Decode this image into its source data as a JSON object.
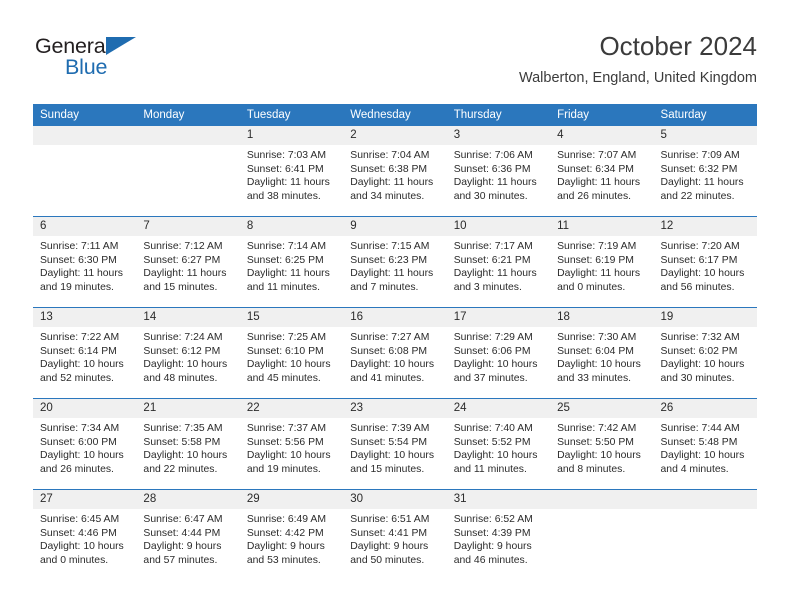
{
  "logo": {
    "word_top": "General",
    "word_bottom": "Blue",
    "accent_color": "#1f6cb0"
  },
  "header": {
    "title": "October 2024",
    "subtitle": "Walberton, England, United Kingdom"
  },
  "calendar": {
    "header_color": "#2b77bd",
    "daynum_band_color": "#f0f0f0",
    "weekday_headers": [
      "Sunday",
      "Monday",
      "Tuesday",
      "Wednesday",
      "Thursday",
      "Friday",
      "Saturday"
    ],
    "weeks": [
      [
        {
          "day": "",
          "sunrise": "",
          "sunset": "",
          "daylight": ""
        },
        {
          "day": "",
          "sunrise": "",
          "sunset": "",
          "daylight": ""
        },
        {
          "day": "1",
          "sunrise": "Sunrise: 7:03 AM",
          "sunset": "Sunset: 6:41 PM",
          "daylight": "Daylight: 11 hours and 38 minutes."
        },
        {
          "day": "2",
          "sunrise": "Sunrise: 7:04 AM",
          "sunset": "Sunset: 6:38 PM",
          "daylight": "Daylight: 11 hours and 34 minutes."
        },
        {
          "day": "3",
          "sunrise": "Sunrise: 7:06 AM",
          "sunset": "Sunset: 6:36 PM",
          "daylight": "Daylight: 11 hours and 30 minutes."
        },
        {
          "day": "4",
          "sunrise": "Sunrise: 7:07 AM",
          "sunset": "Sunset: 6:34 PM",
          "daylight": "Daylight: 11 hours and 26 minutes."
        },
        {
          "day": "5",
          "sunrise": "Sunrise: 7:09 AM",
          "sunset": "Sunset: 6:32 PM",
          "daylight": "Daylight: 11 hours and 22 minutes."
        }
      ],
      [
        {
          "day": "6",
          "sunrise": "Sunrise: 7:11 AM",
          "sunset": "Sunset: 6:30 PM",
          "daylight": "Daylight: 11 hours and 19 minutes."
        },
        {
          "day": "7",
          "sunrise": "Sunrise: 7:12 AM",
          "sunset": "Sunset: 6:27 PM",
          "daylight": "Daylight: 11 hours and 15 minutes."
        },
        {
          "day": "8",
          "sunrise": "Sunrise: 7:14 AM",
          "sunset": "Sunset: 6:25 PM",
          "daylight": "Daylight: 11 hours and 11 minutes."
        },
        {
          "day": "9",
          "sunrise": "Sunrise: 7:15 AM",
          "sunset": "Sunset: 6:23 PM",
          "daylight": "Daylight: 11 hours and 7 minutes."
        },
        {
          "day": "10",
          "sunrise": "Sunrise: 7:17 AM",
          "sunset": "Sunset: 6:21 PM",
          "daylight": "Daylight: 11 hours and 3 minutes."
        },
        {
          "day": "11",
          "sunrise": "Sunrise: 7:19 AM",
          "sunset": "Sunset: 6:19 PM",
          "daylight": "Daylight: 11 hours and 0 minutes."
        },
        {
          "day": "12",
          "sunrise": "Sunrise: 7:20 AM",
          "sunset": "Sunset: 6:17 PM",
          "daylight": "Daylight: 10 hours and 56 minutes."
        }
      ],
      [
        {
          "day": "13",
          "sunrise": "Sunrise: 7:22 AM",
          "sunset": "Sunset: 6:14 PM",
          "daylight": "Daylight: 10 hours and 52 minutes."
        },
        {
          "day": "14",
          "sunrise": "Sunrise: 7:24 AM",
          "sunset": "Sunset: 6:12 PM",
          "daylight": "Daylight: 10 hours and 48 minutes."
        },
        {
          "day": "15",
          "sunrise": "Sunrise: 7:25 AM",
          "sunset": "Sunset: 6:10 PM",
          "daylight": "Daylight: 10 hours and 45 minutes."
        },
        {
          "day": "16",
          "sunrise": "Sunrise: 7:27 AM",
          "sunset": "Sunset: 6:08 PM",
          "daylight": "Daylight: 10 hours and 41 minutes."
        },
        {
          "day": "17",
          "sunrise": "Sunrise: 7:29 AM",
          "sunset": "Sunset: 6:06 PM",
          "daylight": "Daylight: 10 hours and 37 minutes."
        },
        {
          "day": "18",
          "sunrise": "Sunrise: 7:30 AM",
          "sunset": "Sunset: 6:04 PM",
          "daylight": "Daylight: 10 hours and 33 minutes."
        },
        {
          "day": "19",
          "sunrise": "Sunrise: 7:32 AM",
          "sunset": "Sunset: 6:02 PM",
          "daylight": "Daylight: 10 hours and 30 minutes."
        }
      ],
      [
        {
          "day": "20",
          "sunrise": "Sunrise: 7:34 AM",
          "sunset": "Sunset: 6:00 PM",
          "daylight": "Daylight: 10 hours and 26 minutes."
        },
        {
          "day": "21",
          "sunrise": "Sunrise: 7:35 AM",
          "sunset": "Sunset: 5:58 PM",
          "daylight": "Daylight: 10 hours and 22 minutes."
        },
        {
          "day": "22",
          "sunrise": "Sunrise: 7:37 AM",
          "sunset": "Sunset: 5:56 PM",
          "daylight": "Daylight: 10 hours and 19 minutes."
        },
        {
          "day": "23",
          "sunrise": "Sunrise: 7:39 AM",
          "sunset": "Sunset: 5:54 PM",
          "daylight": "Daylight: 10 hours and 15 minutes."
        },
        {
          "day": "24",
          "sunrise": "Sunrise: 7:40 AM",
          "sunset": "Sunset: 5:52 PM",
          "daylight": "Daylight: 10 hours and 11 minutes."
        },
        {
          "day": "25",
          "sunrise": "Sunrise: 7:42 AM",
          "sunset": "Sunset: 5:50 PM",
          "daylight": "Daylight: 10 hours and 8 minutes."
        },
        {
          "day": "26",
          "sunrise": "Sunrise: 7:44 AM",
          "sunset": "Sunset: 5:48 PM",
          "daylight": "Daylight: 10 hours and 4 minutes."
        }
      ],
      [
        {
          "day": "27",
          "sunrise": "Sunrise: 6:45 AM",
          "sunset": "Sunset: 4:46 PM",
          "daylight": "Daylight: 10 hours and 0 minutes."
        },
        {
          "day": "28",
          "sunrise": "Sunrise: 6:47 AM",
          "sunset": "Sunset: 4:44 PM",
          "daylight": "Daylight: 9 hours and 57 minutes."
        },
        {
          "day": "29",
          "sunrise": "Sunrise: 6:49 AM",
          "sunset": "Sunset: 4:42 PM",
          "daylight": "Daylight: 9 hours and 53 minutes."
        },
        {
          "day": "30",
          "sunrise": "Sunrise: 6:51 AM",
          "sunset": "Sunset: 4:41 PM",
          "daylight": "Daylight: 9 hours and 50 minutes."
        },
        {
          "day": "31",
          "sunrise": "Sunrise: 6:52 AM",
          "sunset": "Sunset: 4:39 PM",
          "daylight": "Daylight: 9 hours and 46 minutes."
        },
        {
          "day": "",
          "sunrise": "",
          "sunset": "",
          "daylight": ""
        },
        {
          "day": "",
          "sunrise": "",
          "sunset": "",
          "daylight": ""
        }
      ]
    ]
  }
}
